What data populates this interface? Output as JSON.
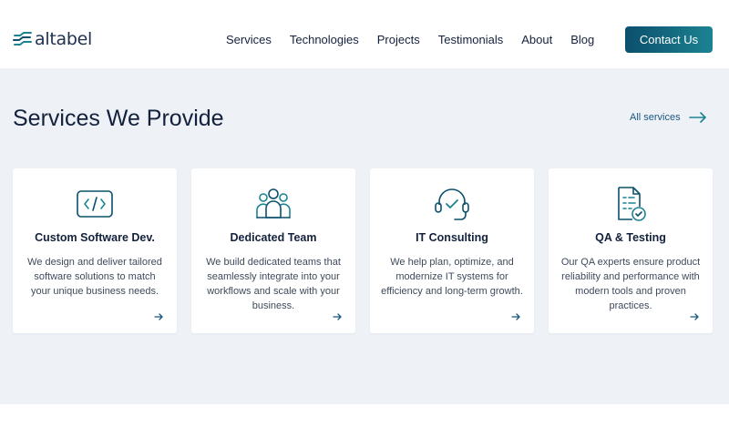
{
  "brand": {
    "name": "altabel",
    "color": "#0b4f6c",
    "accent": "#1c8392"
  },
  "nav": {
    "items": [
      "Services",
      "Technologies",
      "Projects",
      "Testimonials",
      "About",
      "Blog"
    ],
    "contact_label": "Contact Us"
  },
  "services": {
    "title": "Services We Provide",
    "all_label": "All services",
    "cards": [
      {
        "icon": "code-icon",
        "title": "Custom Software Dev.",
        "description": "We design and deliver tailored software solutions to match your unique business needs."
      },
      {
        "icon": "team-icon",
        "title": "Dedicated Team",
        "description": "We build dedicated teams that seamlessly integrate into your workflows and scale with your business."
      },
      {
        "icon": "headset-icon",
        "title": "IT Consulting",
        "description": "We help plan, optimize, and modernize IT systems for efficiency and long-term growth."
      },
      {
        "icon": "checklist-icon",
        "title": "QA & Testing",
        "description": "Our QA experts ensure product reliability and performance with modern tools and proven practices."
      }
    ]
  }
}
